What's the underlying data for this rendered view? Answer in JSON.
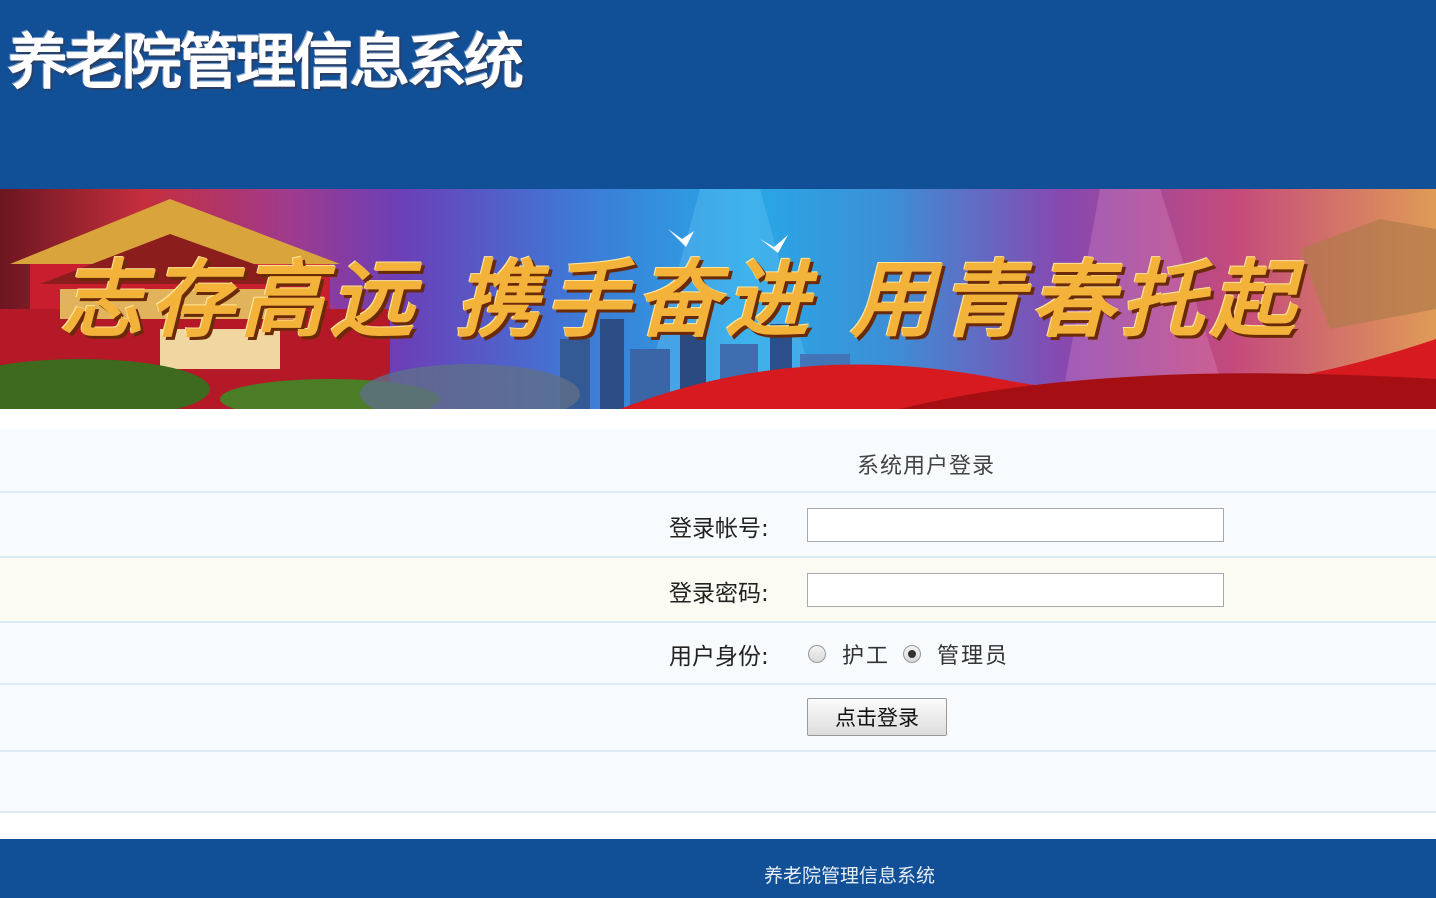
{
  "header": {
    "title": "养老院管理信息系统"
  },
  "banner": {
    "slogan": "志存高远 携手奋进 用青春托起"
  },
  "login": {
    "title": "系统用户登录",
    "username_label": "登录帐号:",
    "username_value": "",
    "password_label": "登录密码:",
    "password_value": "",
    "role_label": "用户身份:",
    "roles": [
      {
        "label": "护工",
        "checked": false
      },
      {
        "label": "管理员",
        "checked": true
      }
    ],
    "submit_label": "点击登录"
  },
  "footer": {
    "text": "养老院管理信息系统"
  },
  "colors": {
    "brand_blue": "#114f96",
    "row_border": "#dcebf3",
    "slogan_gold": "#f3b23a"
  }
}
